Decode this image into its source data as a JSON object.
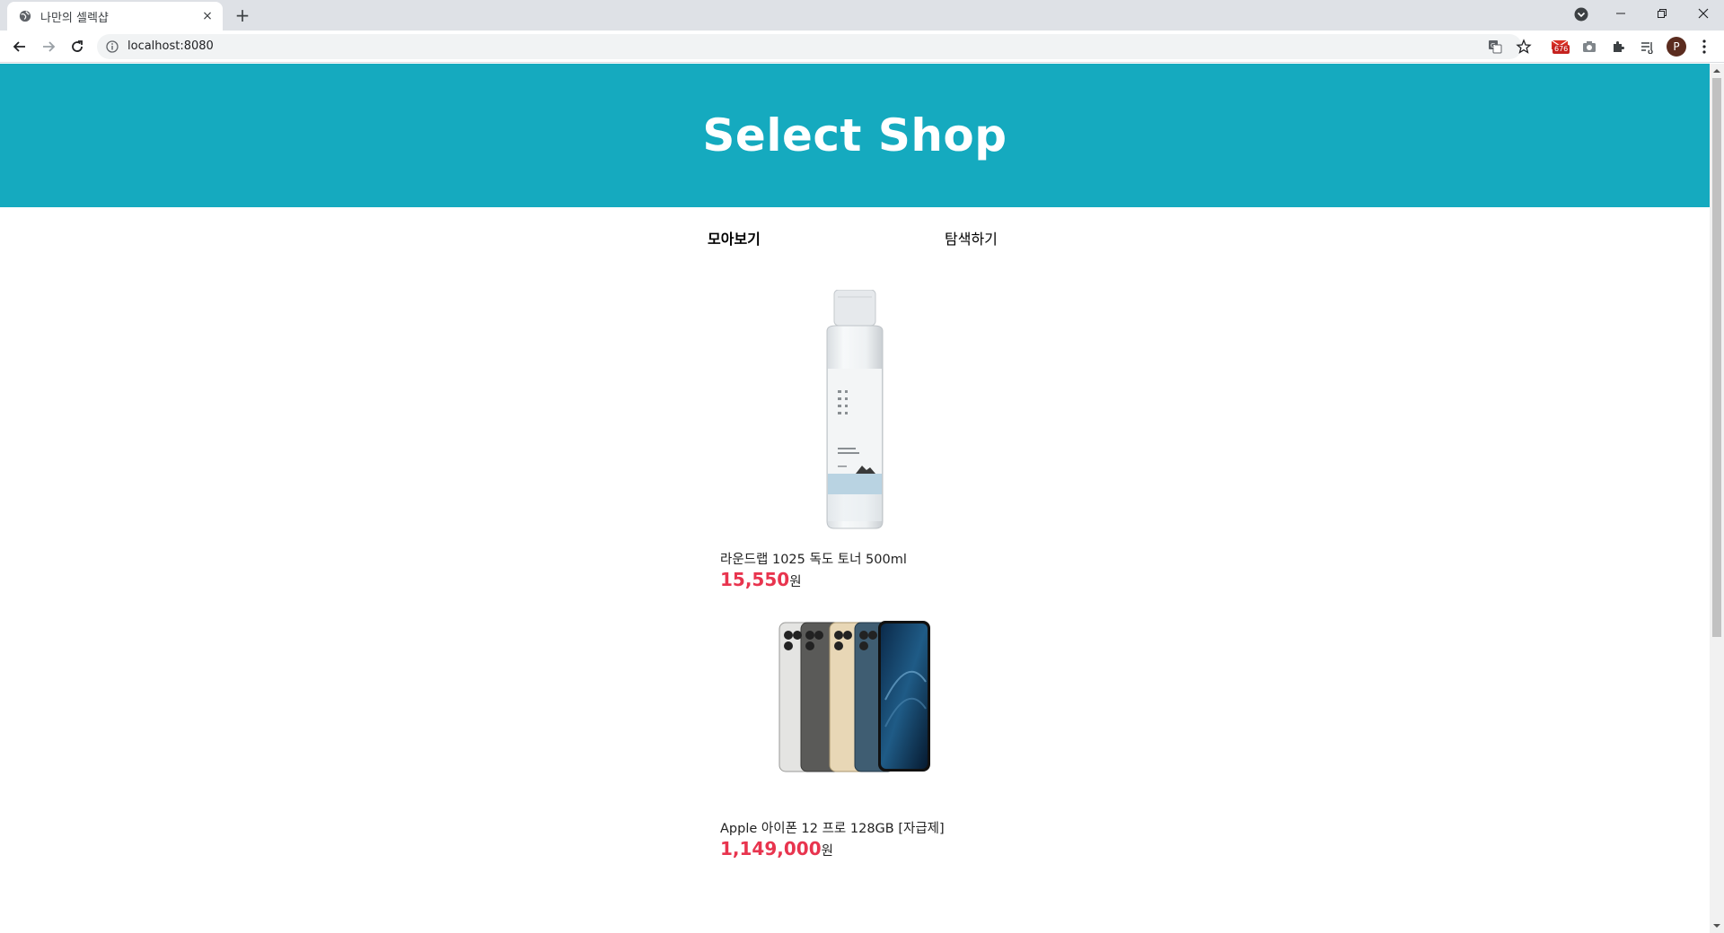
{
  "browser": {
    "tab_title": "나만의 셀렉샵",
    "tab_close": "×",
    "new_tab": "+",
    "url": "localhost:8080",
    "gmail_count": "676",
    "profile_initial": "P"
  },
  "page": {
    "header_title": "Select Shop",
    "nav": {
      "items": [
        {
          "label": "모아보기",
          "active": true
        },
        {
          "label": "탐색하기",
          "active": false
        }
      ]
    },
    "products": [
      {
        "title": "라운드랩 1025 독도 토너 500ml",
        "price": "15,550",
        "currency": "원",
        "image": "toner-bottle"
      },
      {
        "title": "Apple 아이폰 12 프로 128GB [자급제]",
        "price": "1,149,000",
        "currency": "원",
        "image": "iphone-12-pro"
      }
    ]
  },
  "colors": {
    "header_bg": "#15aabf",
    "price": "#e8344e",
    "tab_strip": "#dee1e6"
  }
}
